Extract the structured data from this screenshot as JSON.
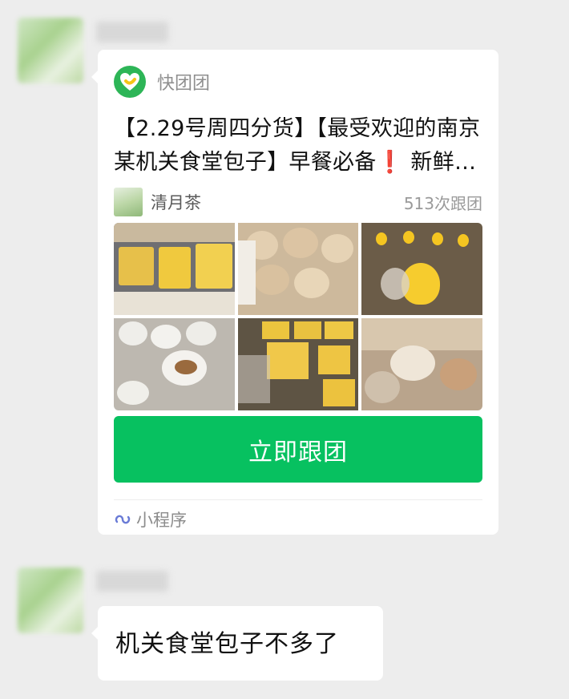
{
  "card": {
    "app_name": "快团团",
    "title_prefix": "【2.29号周四分货】【最受欢迎的南京某机关食堂包子】早餐必备",
    "title_emoji": "❗",
    "title_suffix": " 新鲜出炉",
    "leader_name": "清月茶",
    "join_count": "513次跟团",
    "button_label": "立即跟团",
    "footer_label": "小程序",
    "photos": [
      "buns-assortment-photo",
      "shaobing-pile-photo",
      "yellow-pear-buns-photo",
      "steamed-baozi-photo",
      "jujube-cake-photo",
      "stuffed-pastry-photo"
    ]
  },
  "message": {
    "text": "机关食堂包子不多了"
  },
  "colors": {
    "background": "#ededed",
    "bubble": "#ffffff",
    "cta": "#07c160",
    "app_logo": "#2db557",
    "exclamation": "#e02020"
  }
}
